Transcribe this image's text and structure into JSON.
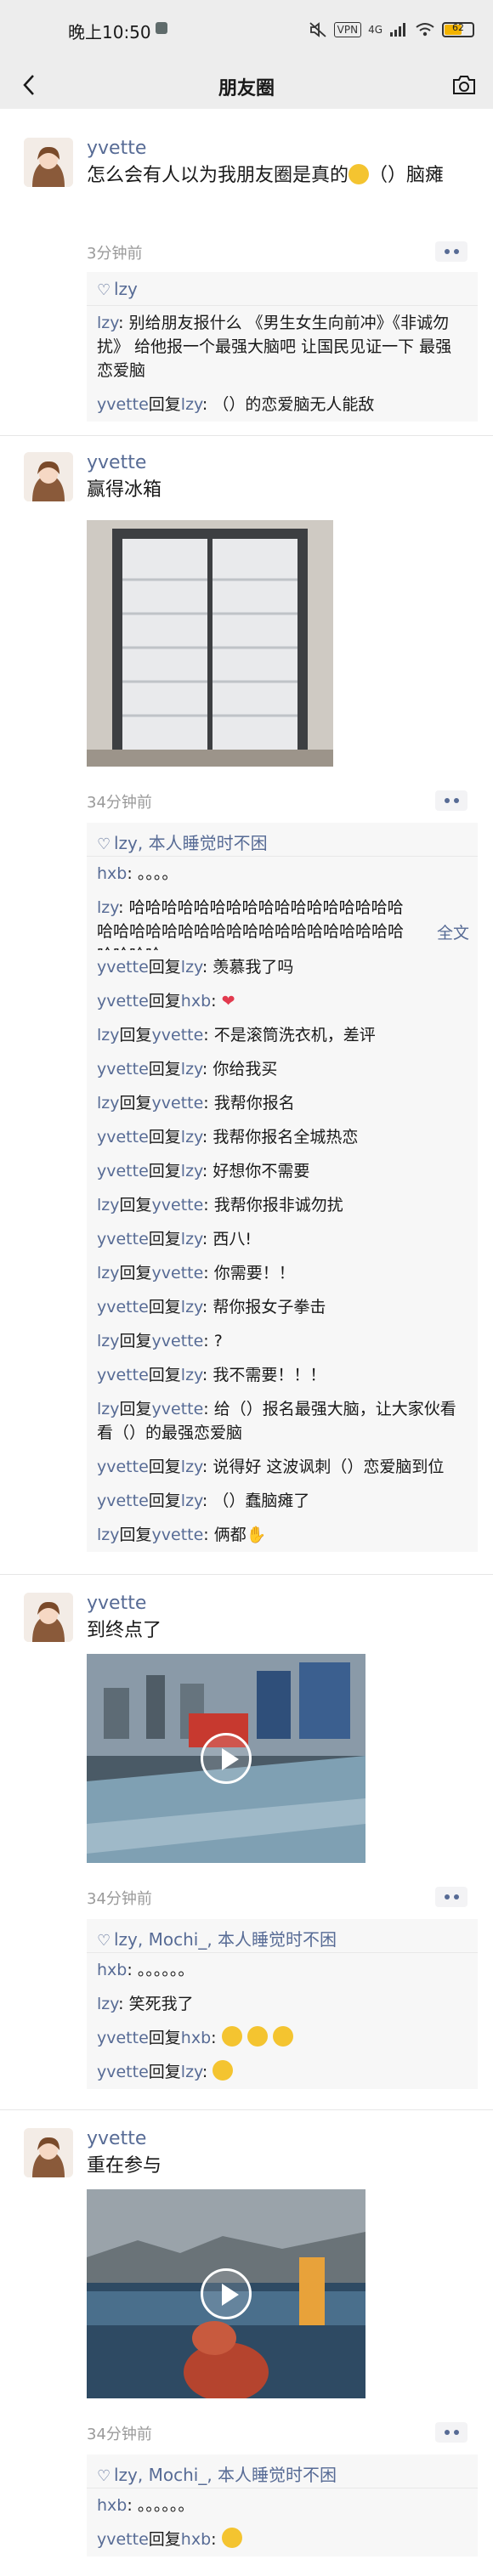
{
  "status": {
    "time": "晚上10:50",
    "vpn": "VPN",
    "network": "4G",
    "battery": "62"
  },
  "nav": {
    "title": "朋友圈"
  },
  "posts": [
    {
      "nick": "yvette",
      "text": "怎么会有人以为我朋友圈是真的",
      "text_tail": "（）脑瘫",
      "time": "3分钟前",
      "likes": "lzy",
      "comments": [
        {
          "who": "lzy",
          "sep": ": ",
          "text": "别给朋友报什么 《男生女生向前冲》《非诚勿扰》 给他报一个最强大脑吧 让国民见证一下 最强恋爱脑"
        },
        {
          "who": "yvette",
          "reply": "回复",
          "to": "lzy",
          "sep": ": ",
          "text": "（）的恋爱脑无人能敌"
        }
      ]
    },
    {
      "nick": "yvette",
      "text": "赢得冰箱",
      "time": "34分钟前",
      "likes": "lzy, 本人睡觉时不困",
      "comments": [
        {
          "who": "hxb",
          "sep": ": ",
          "text": "。。。。"
        },
        {
          "who": "lzy",
          "sep": ": ",
          "text": "哈哈哈哈哈哈哈哈哈哈哈哈哈哈哈哈哈哈哈哈哈哈哈哈哈哈哈哈哈哈哈哈哈哈哈哈哈哈哈哈...",
          "more": "全文"
        },
        {
          "who": "yvette",
          "reply": "回复",
          "to": "lzy",
          "sep": ": ",
          "text": "羡慕我了吗"
        },
        {
          "who": "yvette",
          "reply": "回复",
          "to": "hxb",
          "sep": ": ",
          "text": "❤"
        },
        {
          "who": "lzy",
          "reply": "回复",
          "to": "yvette",
          "sep": ": ",
          "text": "不是滚筒洗衣机，差评"
        },
        {
          "who": "yvette",
          "reply": "回复",
          "to": "lzy",
          "sep": ": ",
          "text": "你给我买"
        },
        {
          "who": "lzy",
          "reply": "回复",
          "to": "yvette",
          "sep": ": ",
          "text": "我帮你报名"
        },
        {
          "who": "yvette",
          "reply": "回复",
          "to": "lzy",
          "sep": ": ",
          "text": "我帮你报名全城热恋"
        },
        {
          "who": "yvette",
          "reply": "回复",
          "to": "lzy",
          "sep": ": ",
          "text": "好想你不需要"
        },
        {
          "who": "lzy",
          "reply": "回复",
          "to": "yvette",
          "sep": ": ",
          "text": "我帮你报非诚勿扰"
        },
        {
          "who": "yvette",
          "reply": "回复",
          "to": "lzy",
          "sep": ": ",
          "text": "西八!"
        },
        {
          "who": "lzy",
          "reply": "回复",
          "to": "yvette",
          "sep": ": ",
          "text": "你需要！！"
        },
        {
          "who": "yvette",
          "reply": "回复",
          "to": "lzy",
          "sep": ": ",
          "text": "帮你报女子拳击"
        },
        {
          "who": "lzy",
          "reply": "回复",
          "to": "yvette",
          "sep": ": ",
          "text": "?"
        },
        {
          "who": "yvette",
          "reply": "回复",
          "to": "lzy",
          "sep": ": ",
          "text": "我不需要！！！"
        },
        {
          "who": "lzy",
          "reply": "回复",
          "to": "yvette",
          "sep": ": ",
          "text": "给（）报名最强大脑，让大家伙看看（）的最强恋爱脑"
        },
        {
          "who": "yvette",
          "reply": "回复",
          "to": "lzy",
          "sep": ": ",
          "text": "说得好 这波讽刺（）恋爱脑到位"
        },
        {
          "who": "yvette",
          "reply": "回复",
          "to": "lzy",
          "sep": ": ",
          "text": "（）蠢脑瘫了"
        },
        {
          "who": "lzy",
          "reply": "回复",
          "to": "yvette",
          "sep": ": ",
          "text": "俩都"
        }
      ]
    },
    {
      "nick": "yvette",
      "text": "到终点了",
      "time": "34分钟前",
      "likes": "lzy, Mochi_, 本人睡觉时不困",
      "comments": [
        {
          "who": "hxb",
          "sep": ": ",
          "text": "。。。。。。"
        },
        {
          "who": "lzy",
          "sep": ": ",
          "text": "笑死我了"
        },
        {
          "who": "yvette",
          "reply": "回复",
          "to": "hxb",
          "sep": ": ",
          "text": ""
        },
        {
          "who": "yvette",
          "reply": "回复",
          "to": "lzy",
          "sep": ": ",
          "text": ""
        }
      ]
    },
    {
      "nick": "yvette",
      "text": "重在参与",
      "time": "34分钟前",
      "likes": "lzy, Mochi_, 本人睡觉时不困",
      "comments": [
        {
          "who": "hxb",
          "sep": ": ",
          "text": "。。。。。。"
        },
        {
          "who": "yvette",
          "reply": "回复",
          "to": "hxb",
          "sep": ": ",
          "text": ""
        }
      ]
    }
  ]
}
